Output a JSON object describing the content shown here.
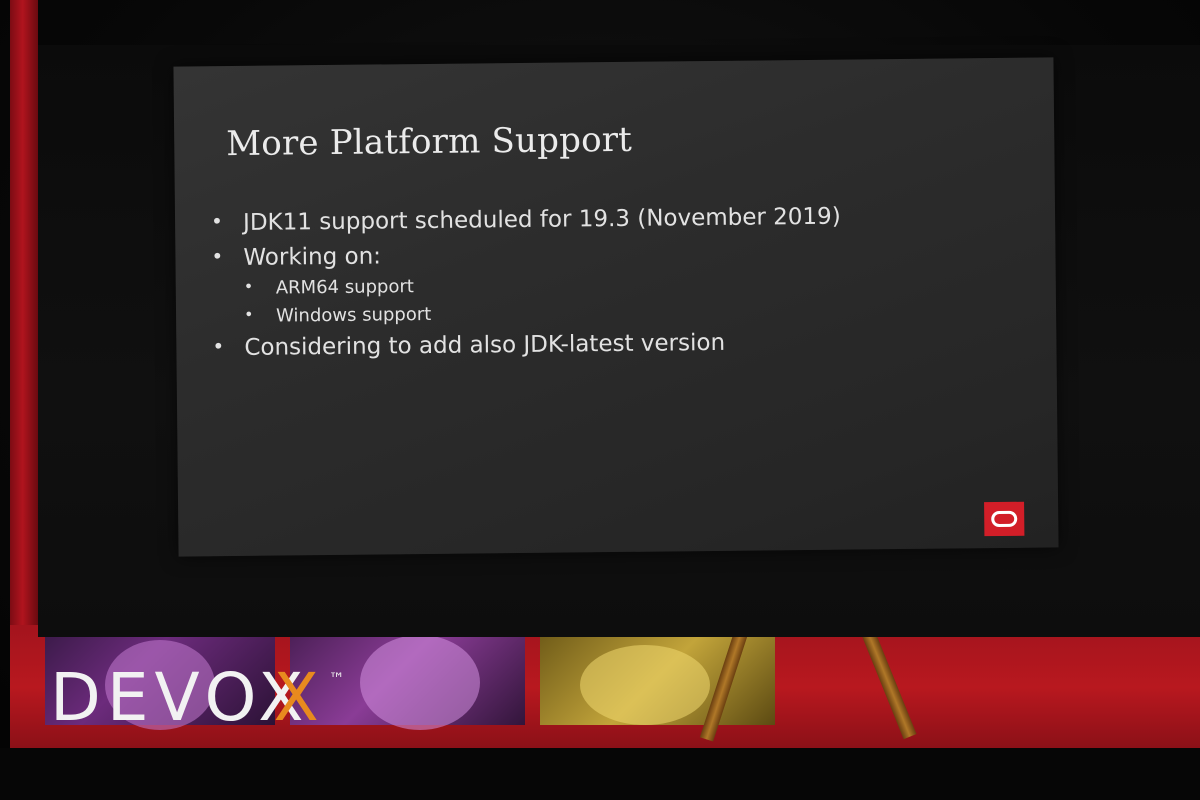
{
  "slide": {
    "title": "More Platform Support",
    "bullets": [
      "JDK11 support scheduled for 19.3 (November 2019)",
      "Working on:",
      "Considering to add also JDK-latest version"
    ],
    "sub_bullets": [
      "ARM64 support",
      "Windows support"
    ],
    "logo_icon": "oracle-logo-icon",
    "logo_color": "#d21e28"
  },
  "banner": {
    "logo_letters": "DEVOX",
    "logo_accent": "X",
    "logo_trademark": "™",
    "accent_color": "#e88a1e",
    "stage_color": "#b0141e"
  }
}
